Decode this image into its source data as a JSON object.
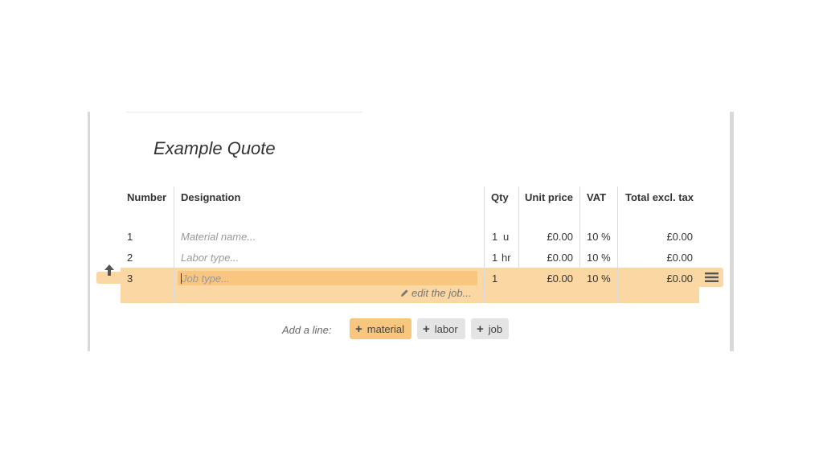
{
  "quote": {
    "title": "Example Quote"
  },
  "table": {
    "headers": {
      "number": "Number",
      "designation": "Designation",
      "qty": "Qty",
      "unit_price": "Unit price",
      "vat": "VAT",
      "total": "Total excl. tax"
    },
    "rows": [
      {
        "number": "1",
        "designation_placeholder": "Material name...",
        "qty": "1",
        "unit": "u",
        "unit_price": "£0.00",
        "vat": "10 %",
        "total": "£0.00"
      },
      {
        "number": "2",
        "designation_placeholder": "Labor type...",
        "qty": "1",
        "unit": "hr",
        "unit_price": "£0.00",
        "vat": "10 %",
        "total": "£0.00"
      },
      {
        "number": "3",
        "designation_placeholder": "Job type...",
        "qty": "1",
        "unit": "",
        "unit_price": "£0.00",
        "vat": "10 %",
        "total": "£0.00",
        "edit_link": "edit the job..."
      }
    ]
  },
  "add_line": {
    "label": "Add a line:",
    "buttons": [
      {
        "label": "material"
      },
      {
        "label": "labor"
      },
      {
        "label": "job"
      }
    ]
  },
  "colors": {
    "selected_row": "#fad7a3",
    "accent": "#f8c67f",
    "button_gray": "#e4e4e4"
  },
  "icons": {
    "move_up": "arrow-up-icon",
    "row_menu": "hamburger-menu-icon",
    "edit": "pencil-icon",
    "add": "plus-icon"
  }
}
